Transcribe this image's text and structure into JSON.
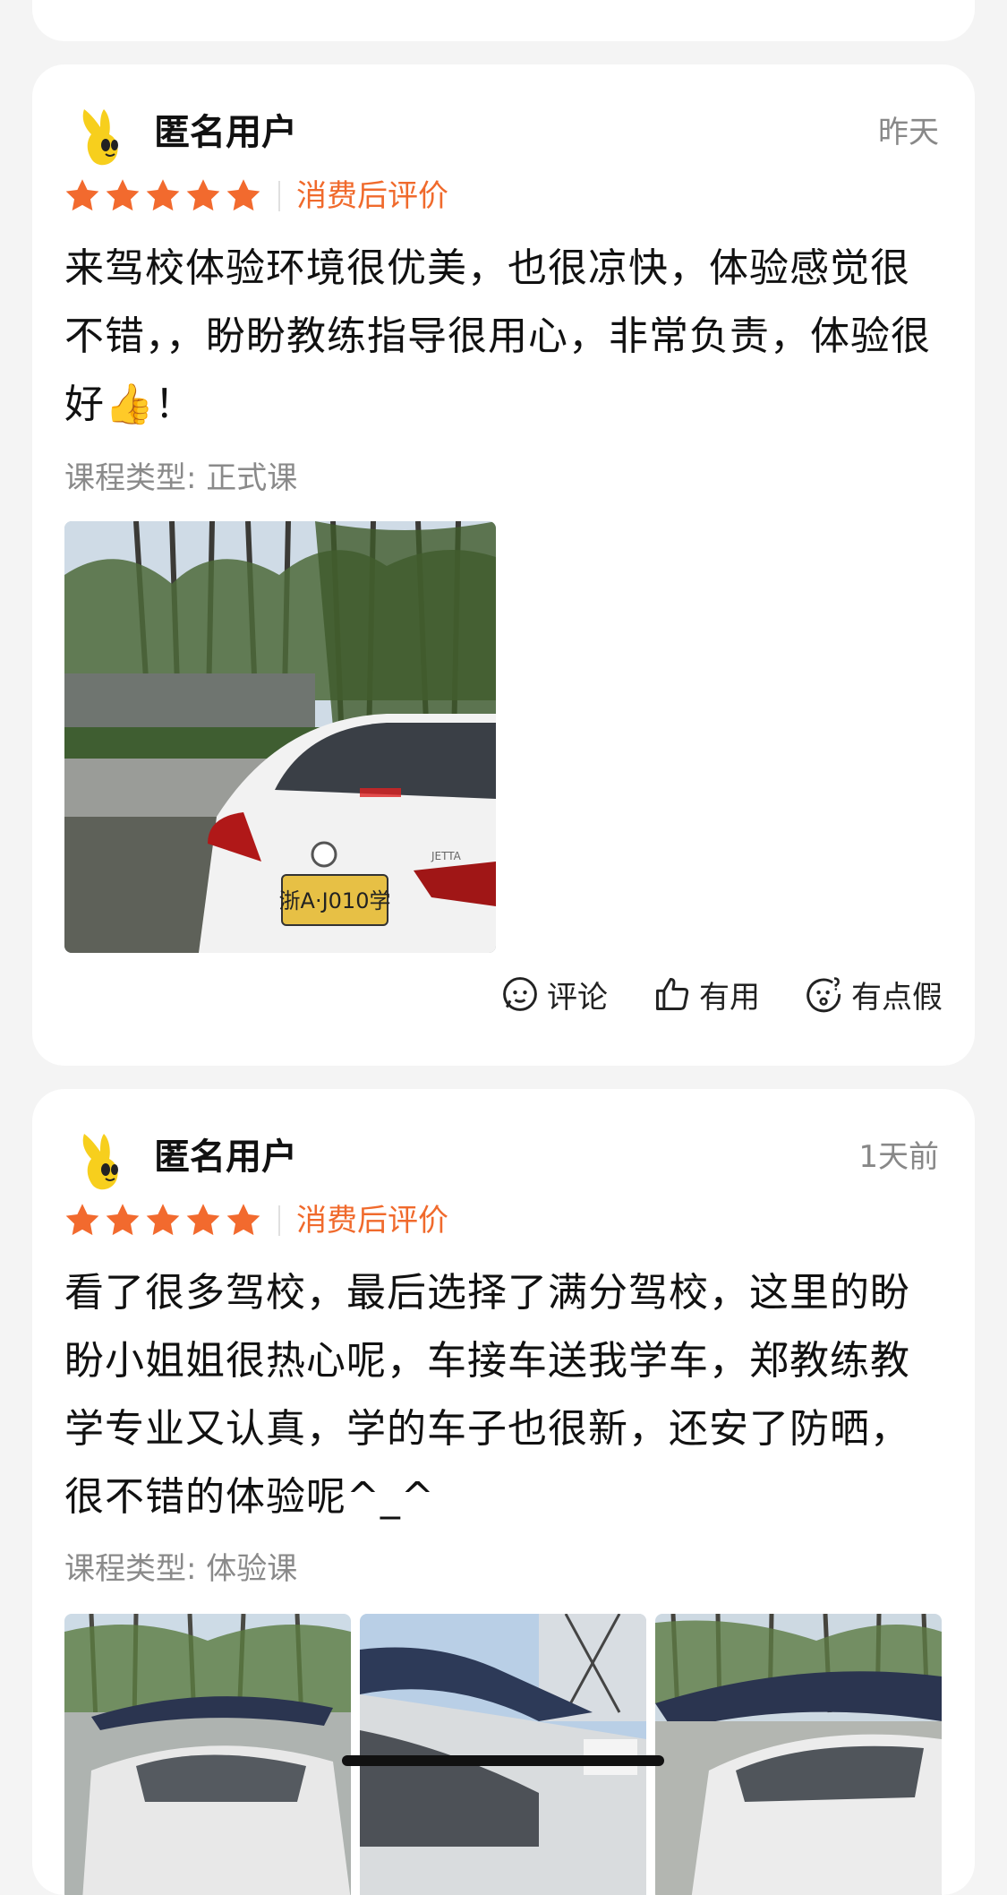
{
  "reviews": [
    {
      "username": "匿名用户",
      "time": "昨天",
      "rating": 5,
      "tag": "消费后评价",
      "text": "来驾校体验环境很优美，也很凉快，体验感觉很不错，，盼盼教练指导很用心，非常负责，体验很好👍！",
      "course_type": "课程类型: 正式课",
      "photo_count": 1,
      "plate_text": "浙A·J010学",
      "car_label": "JETTA"
    },
    {
      "username": "匿名用户",
      "time": "1天前",
      "rating": 5,
      "tag": "消费后评价",
      "text": "看了很多驾校，最后选择了满分驾校，这里的盼盼小姐姐很热心呢，车接车送我学车，郑教练教学专业又认真，学的车子也很新，还安了防晒，很不错的体验呢^_^",
      "course_type": "课程类型: 体验课",
      "photo_count": 3
    }
  ],
  "actions": {
    "comment": "评论",
    "useful": "有用",
    "fake": "有点假"
  },
  "colors": {
    "star": "#f26a2e",
    "tag": "#f06a2c",
    "background": "#f4f4f4",
    "card": "#ffffff"
  },
  "icons": [
    "comment-icon",
    "thumbs-up-icon",
    "suspicious-face-icon",
    "star-icon",
    "avatar-mascot-icon"
  ]
}
